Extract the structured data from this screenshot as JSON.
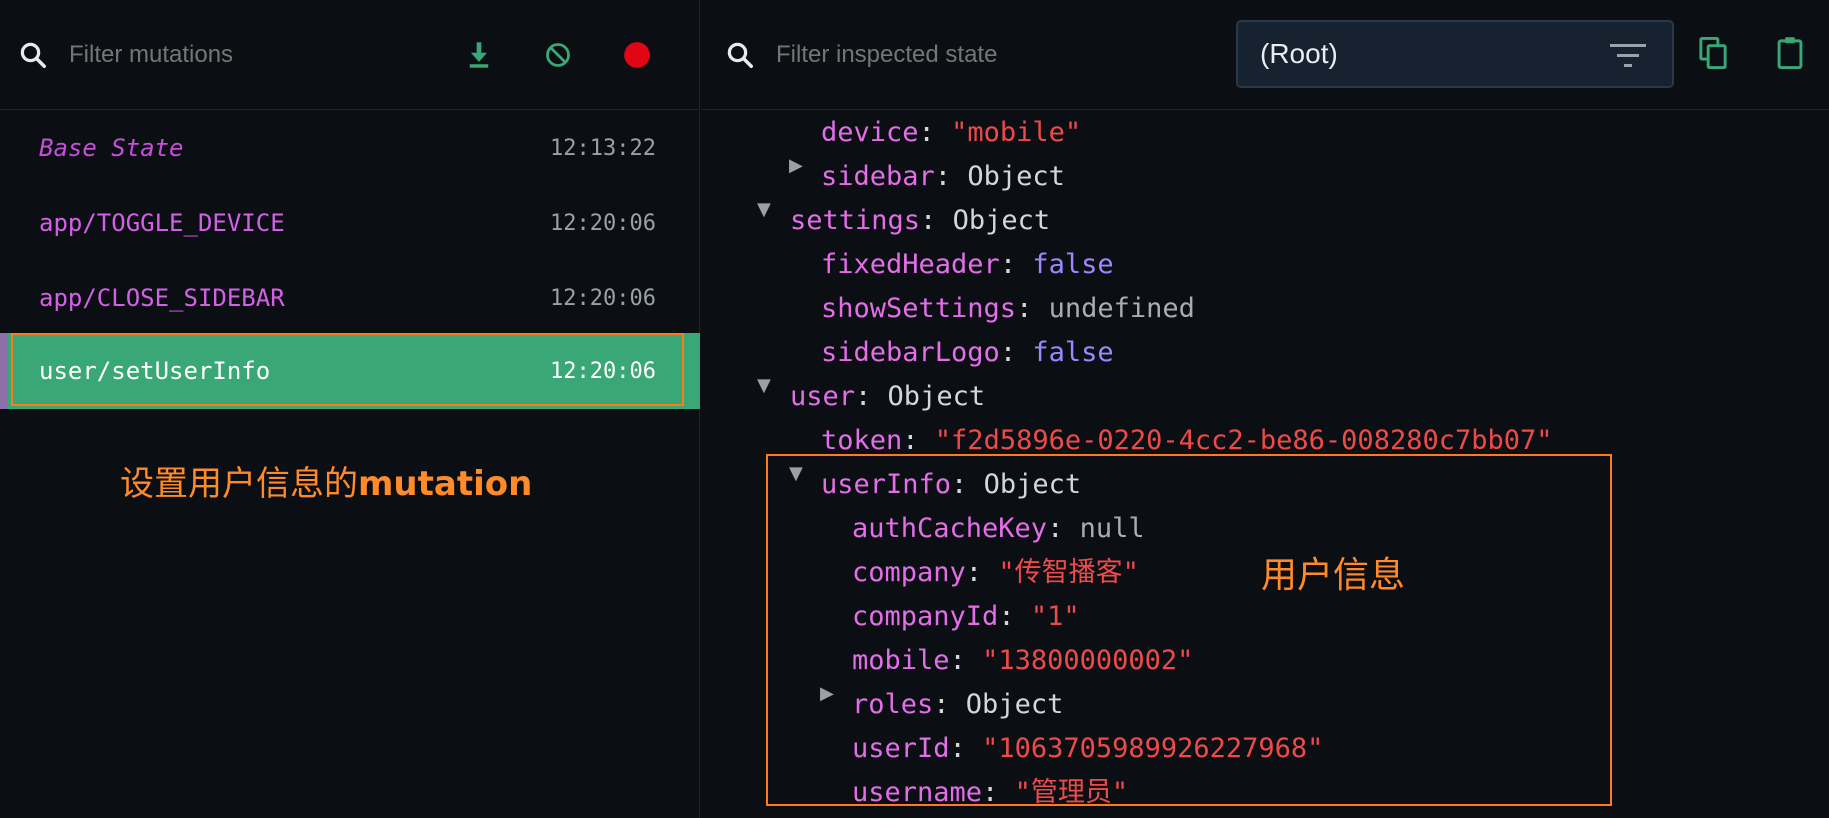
{
  "left": {
    "filter_placeholder": "Filter mutations",
    "icons": {
      "search": "search-icon",
      "download": "download-icon",
      "clear": "block-icon",
      "record": "record-icon"
    },
    "mutations": [
      {
        "name": "Base State",
        "time": "12:13:22"
      },
      {
        "name": "app/TOGGLE_DEVICE",
        "time": "12:20:06"
      },
      {
        "name": "app/CLOSE_SIDEBAR",
        "time": "12:20:06"
      },
      {
        "name": "user/setUserInfo",
        "time": "12:20:06"
      }
    ],
    "annotation": {
      "prefix": "设置用户信息的",
      "suffix": "mutation"
    }
  },
  "right": {
    "filter_placeholder": "Filter inspected state",
    "root_select": "(Root)",
    "icons": {
      "filter": "filter-lines-icon",
      "copy": "copy-icon",
      "paste": "clipboard-icon"
    },
    "tree": {
      "device_key": "device",
      "device_val": "\"mobile\"",
      "sidebar_key": "sidebar",
      "sidebar_val": "Object",
      "settings_key": "settings",
      "settings_val": "Object",
      "fixedHeader_key": "fixedHeader",
      "fixedHeader_val": "false",
      "showSettings_key": "showSettings",
      "showSettings_val": "undefined",
      "sidebarLogo_key": "sidebarLogo",
      "sidebarLogo_val": "false",
      "user_key": "user",
      "user_val": "Object",
      "token_key": "token",
      "token_val": "\"f2d5896e-0220-4cc2-be86-008280c7bb07\"",
      "userInfo_key": "userInfo",
      "userInfo_val": "Object",
      "authCacheKey_key": "authCacheKey",
      "authCacheKey_val": "null",
      "company_key": "company",
      "company_val": "\"传智播客\"",
      "companyId_key": "companyId",
      "companyId_val": "\"1\"",
      "mobile_key": "mobile",
      "mobile_val": "\"13800000002\"",
      "roles_key": "roles",
      "roles_val": "Object",
      "userId_key": "userId",
      "userId_val": "\"1063705989926227968\"",
      "username_key": "username",
      "username_val": "\"管理员\""
    },
    "annotation": "用户信息"
  },
  "colors": {
    "accent": "#3aa776",
    "annotation": "#ff7a1a",
    "record": "#e10613"
  }
}
